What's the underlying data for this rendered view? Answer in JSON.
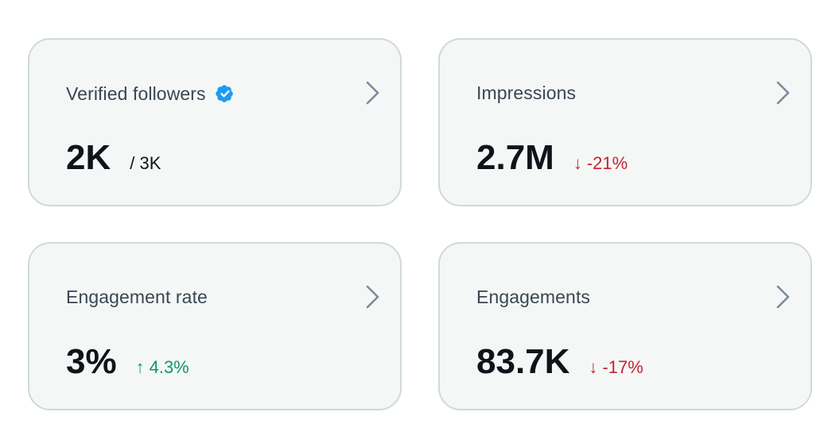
{
  "cards": [
    {
      "title": "Verified followers",
      "value": "2K",
      "sub_value": "/ 3K",
      "icon": "verified-badge-icon"
    },
    {
      "title": "Impressions",
      "value": "2.7M",
      "delta_arrow": "↓",
      "delta": "-21%",
      "trend": "down"
    },
    {
      "title": "Engagement rate",
      "value": "3%",
      "delta_arrow": "↑",
      "delta": "4.3%",
      "trend": "up"
    },
    {
      "title": "Engagements",
      "value": "83.7K",
      "delta_arrow": "↓",
      "delta": "-17%",
      "trend": "down"
    }
  ],
  "colors": {
    "card_background": "#f5f7f7",
    "card_border": "#cfd9de",
    "verified_badge": "#1d9bf0",
    "chevron": "#7b8b9a",
    "down": "#c52330",
    "up": "#0f9a5d"
  }
}
